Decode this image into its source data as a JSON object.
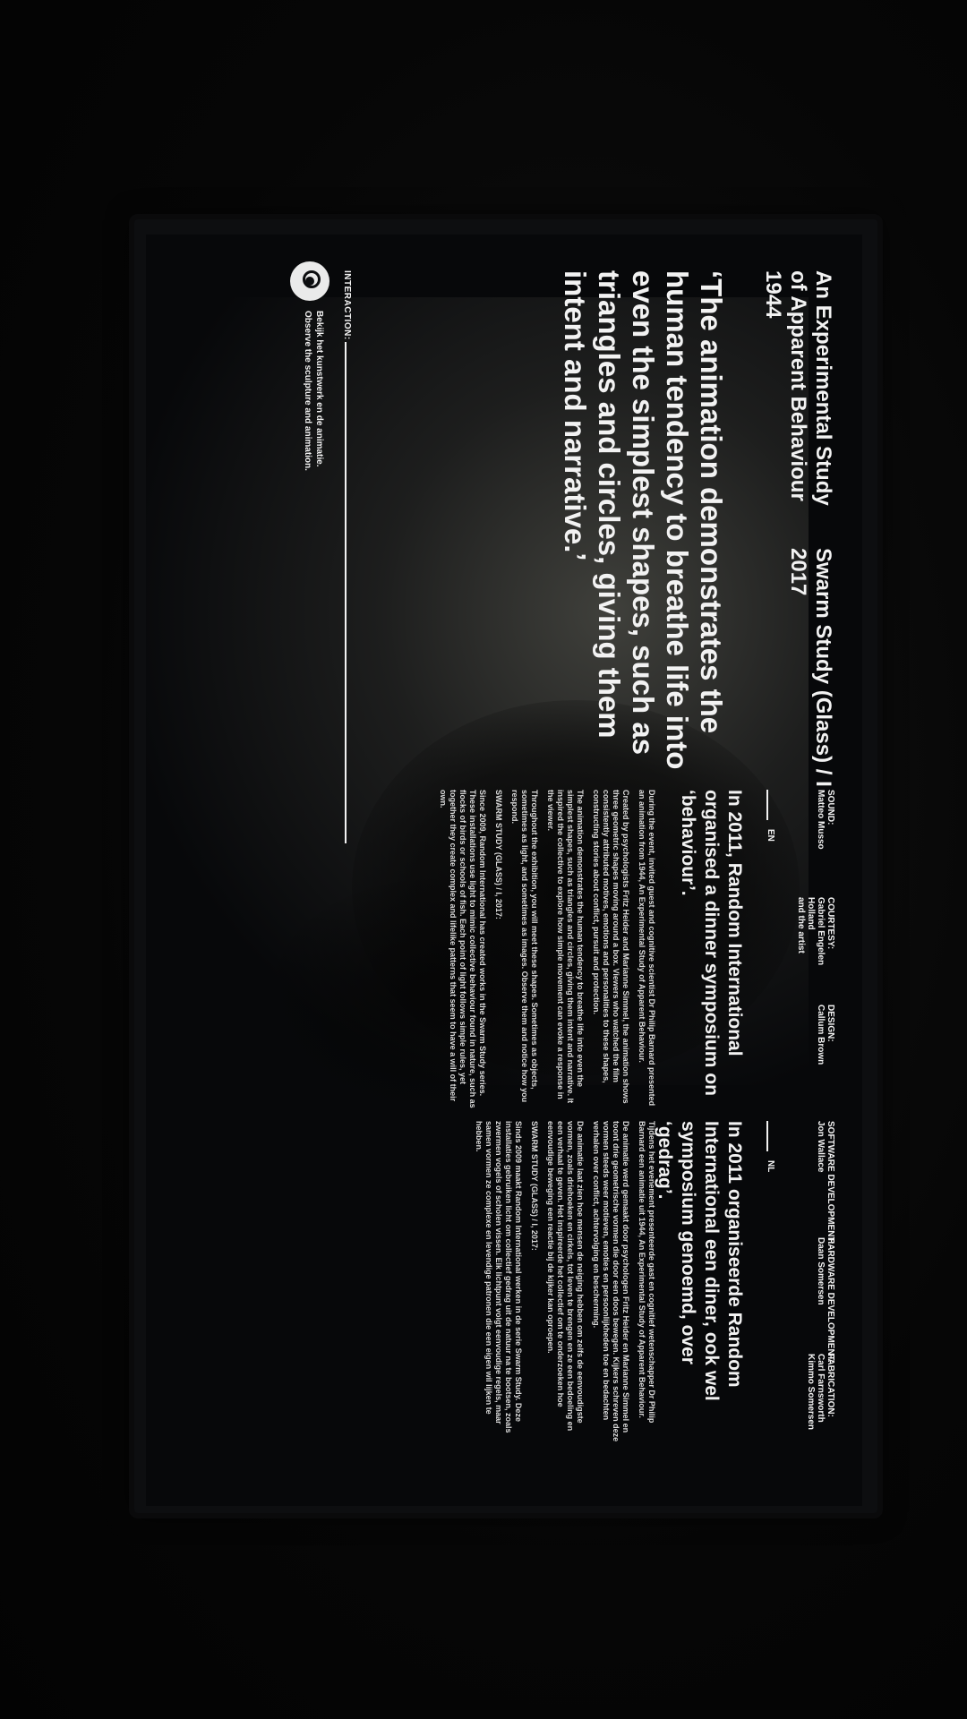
{
  "work": {
    "title": "An Experimental Study\nof Apparent Behaviour\n1944",
    "title_right": "Swarm Study (Glass) / I\n2017",
    "quote": "‘The animation demonstrates the human tendency to breathe life into even the simplest shapes, such as triangles and circles, giving them intent and narrative.’"
  },
  "interaction": {
    "label": "INTERACTION:",
    "instruction_nl": "Bekijk het kunstwerk en de animatie.",
    "instruction_en": "Observe the sculpture and animation."
  },
  "credits": [
    {
      "role": "SOUND:",
      "name": "Matteo Musso"
    },
    {
      "role": "COURTESY:",
      "name": "Gabriel Engelen\nHolland\nand the artist"
    },
    {
      "role": "DESIGN:",
      "name": "Callum Brown"
    },
    {
      "role": "SOFTWARE DEVELOPMENT:",
      "name": "Jon Wallace"
    },
    {
      "role": "HARDWARE DEVELOPMENT:",
      "name": "Daan Somersen"
    },
    {
      "role": "FABRICATION:",
      "name": "Carl Farnsworth\nKimmo Somersen"
    }
  ],
  "en": {
    "lang": "EN",
    "lead": "In 2011, Random International organised a dinner symposium on ‘behaviour’.",
    "paragraphs": [
      "During the event, invited guest and cognitive scientist Dr Philip Barnard presented an animation from 1944, An Experimental Study of Apparent Behaviour.",
      "Created by psychologists Fritz Heider and Marianne Simmel, the animation shows three geometric shapes moving around a box. Viewers who watched the film consistently attributed motives, emotions and personalities to these shapes, constructing stories about conflict, pursuit and protection.",
      "The animation demonstrates the human tendency to breathe life into even the simplest shapes, such as triangles and circles, giving them intent and narrative. It inspired the collective to explore how simple movement can evoke a response in the viewer.",
      "Throughout the exhibition, you will meet these shapes. Sometimes as objects, sometimes as light, and sometimes as images. Observe them and notice how you respond.",
      "SWARM STUDY (GLASS) / I, 2017:",
      "Since 2009, Random International has created works in the Swarm Study series. These installations use light to mimic collective behaviour found in nature, such as flocks of birds or schools of fish. Each point of light follows simple rules, yet together they create complex and lifelike patterns that seem to have a will of their own."
    ]
  },
  "nl": {
    "lang": "NL",
    "lead": "In 2011 organiseerde Random International een diner, ook wel symposium genoemd, over ‘gedrag’.",
    "paragraphs": [
      "Tijdens het evenement presenteerde gast en cognitief wetenschapper Dr Philip Barnard een animatie uit 1944, An Experimental Study of Apparent Behaviour.",
      "De animatie werd gemaakt door psychologen Fritz Heider en Marianne Simmel en toont drie geometrische vormen die door een doos bewegen. Kijkers schreven deze vormen steeds weer motieven, emoties en persoonlijkheden toe en bedachten verhalen over conflict, achtervolging en bescherming.",
      "De animatie laat zien hoe mensen de neiging hebben om zelfs de eenvoudigste vormen, zoals driehoeken en cirkels, tot leven te brengen en ze een bedoeling en een verhaal te geven. Het inspireerde het collectief om te onderzoeken hoe eenvoudige beweging een reactie bij de kijker kan oproepen.",
      "SWARM STUDY (GLASS) / I, 2017:",
      "Sinds 2009 maakt Random International werken in de serie Swarm Study. Deze installaties gebruiken licht om collectief gedrag uit de natuur na te bootsen, zoals zwermen vogels of scholen vissen. Elk lichtpunt volgt eenvoudige regels, maar samen vormen ze complexe en levendige patronen die een eigen wil lijken te hebben."
    ]
  }
}
